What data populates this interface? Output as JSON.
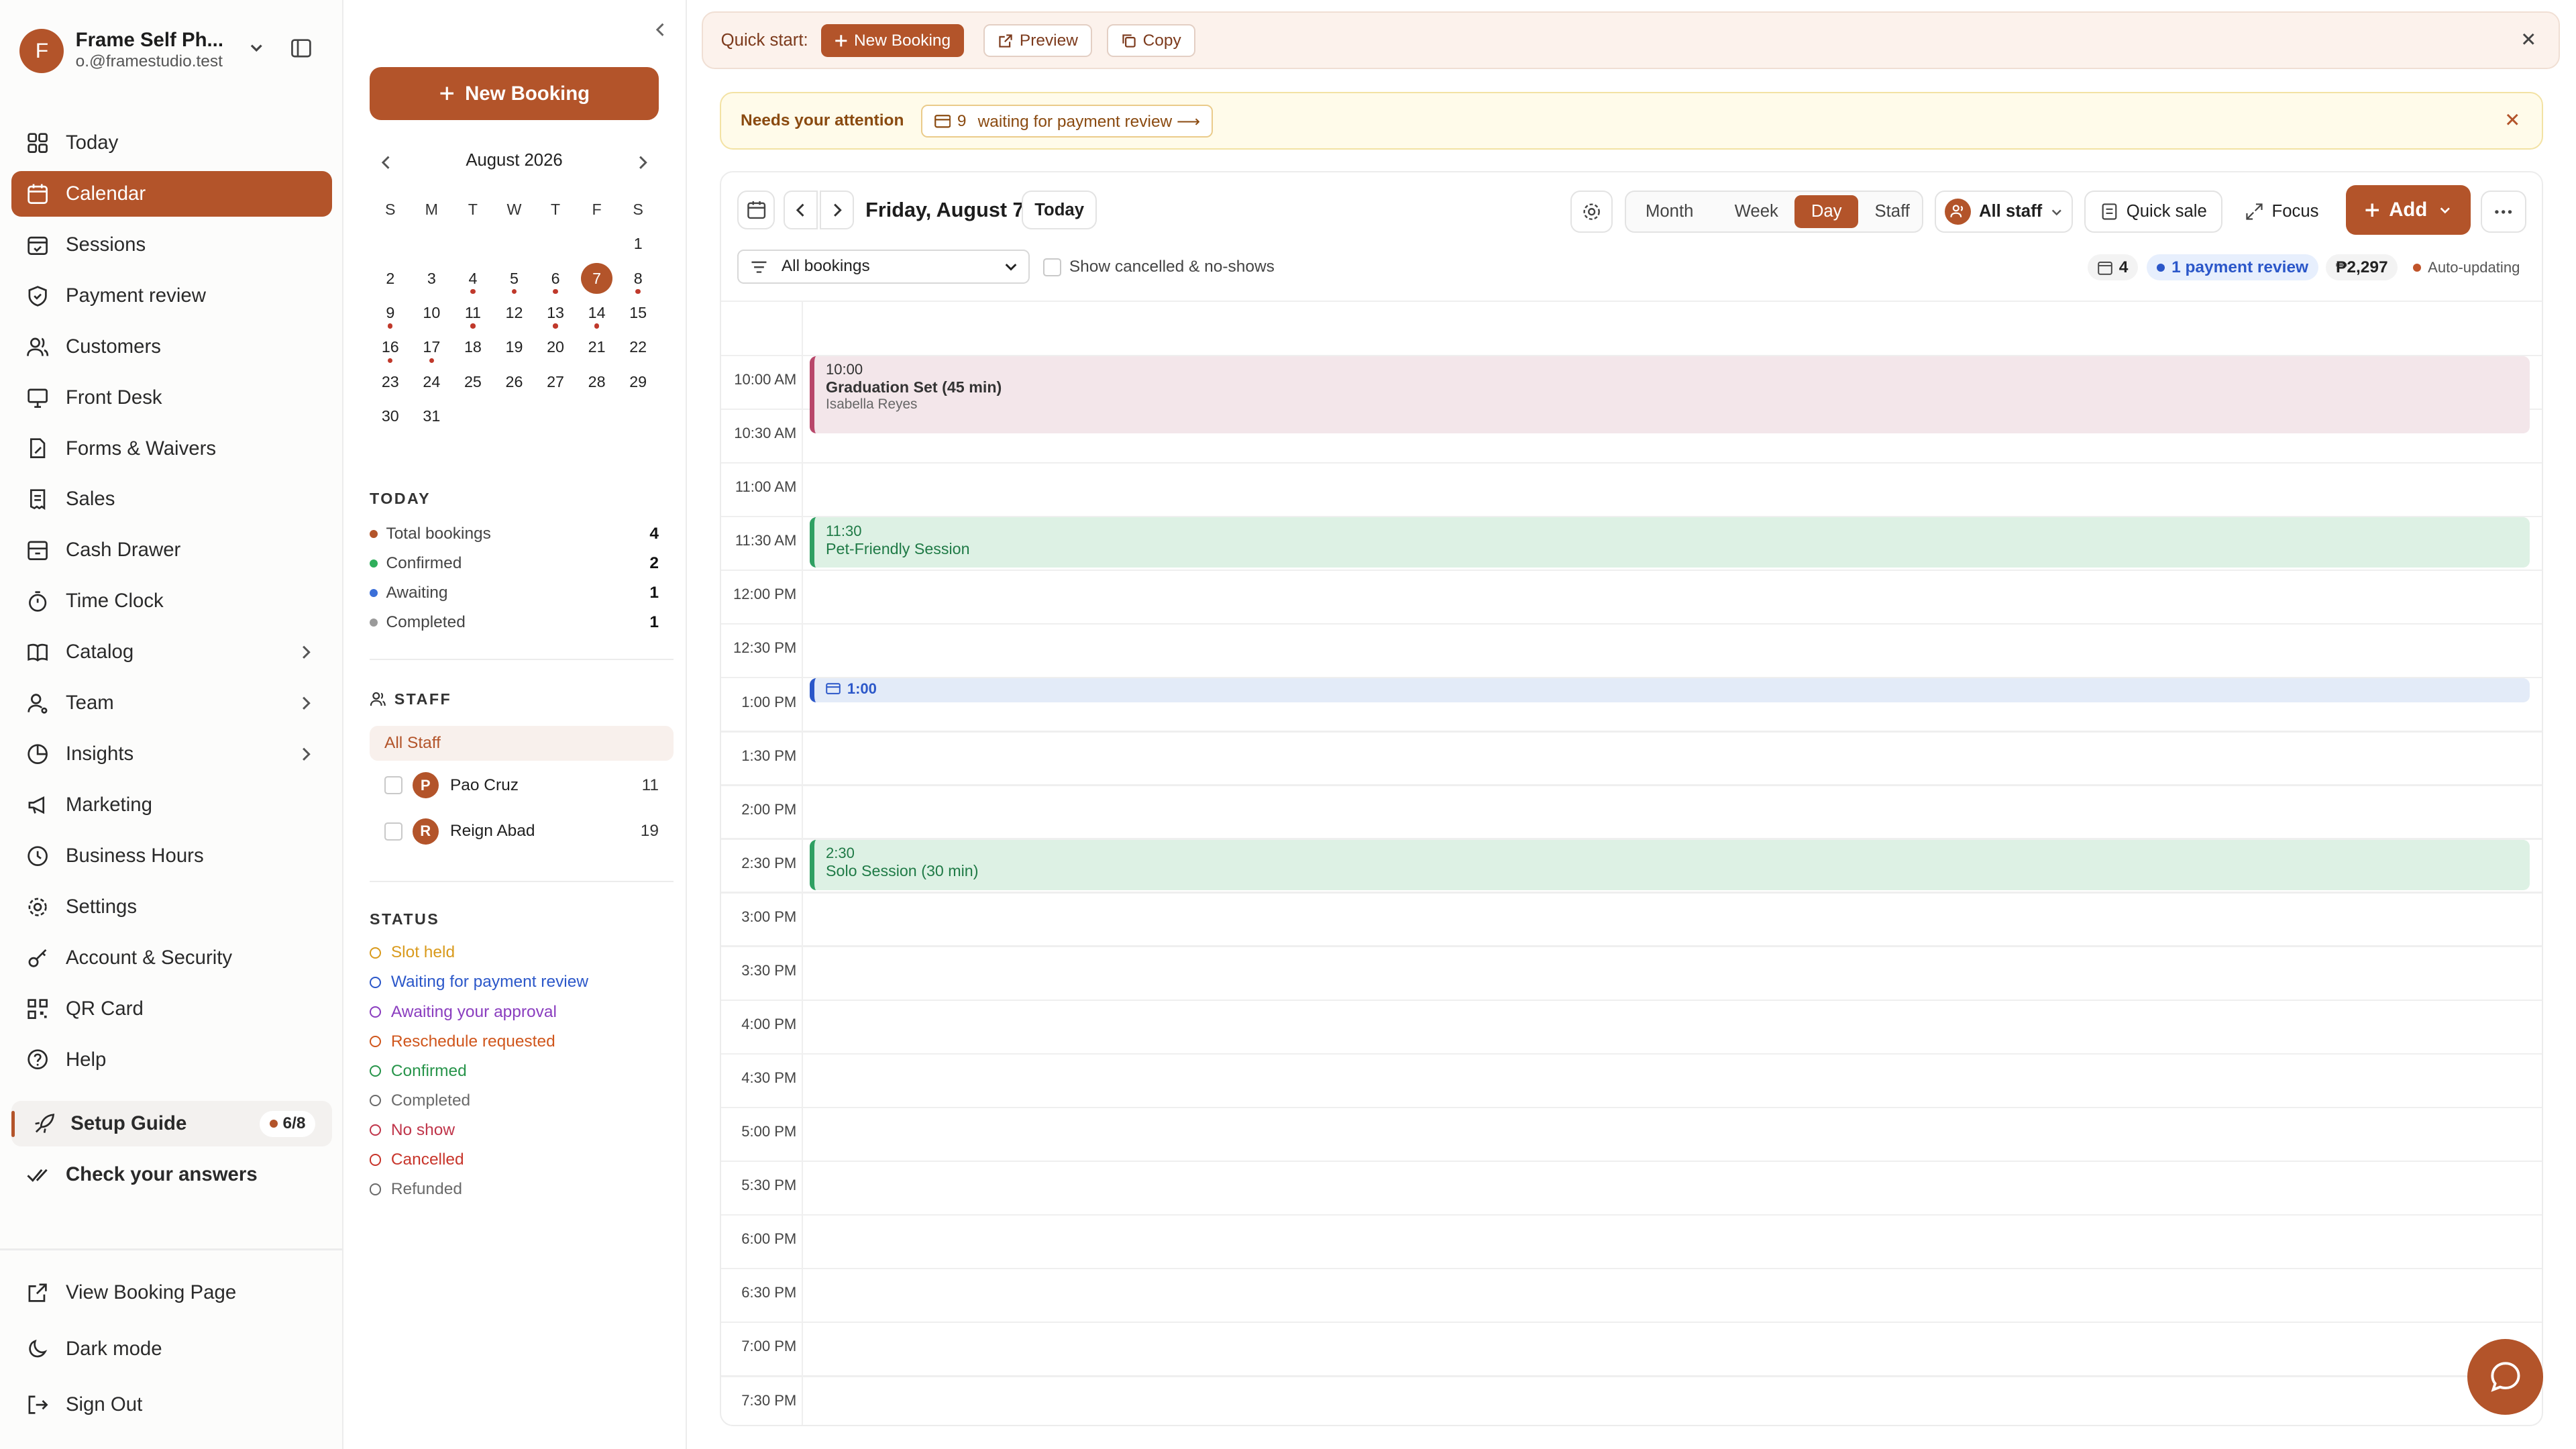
{
  "account": {
    "initial": "F",
    "name": "Frame Self Ph...",
    "email": "o.@framestudio.test"
  },
  "nav": {
    "items": [
      {
        "label": "Today"
      },
      {
        "label": "Calendar"
      },
      {
        "label": "Sessions"
      },
      {
        "label": "Payment review"
      },
      {
        "label": "Customers"
      },
      {
        "label": "Front Desk"
      },
      {
        "label": "Forms & Waivers"
      },
      {
        "label": "Sales"
      },
      {
        "label": "Cash Drawer"
      },
      {
        "label": "Time Clock"
      },
      {
        "label": "Catalog"
      },
      {
        "label": "Team"
      },
      {
        "label": "Insights"
      },
      {
        "label": "Marketing"
      },
      {
        "label": "Business Hours"
      },
      {
        "label": "Settings"
      },
      {
        "label": "Account & Security"
      },
      {
        "label": "QR Card"
      },
      {
        "label": "Help"
      }
    ],
    "setup_guide": {
      "label": "Setup Guide",
      "progress": "6/8"
    },
    "check_answers": "Check your answers",
    "bottom": [
      {
        "label": "View Booking Page"
      },
      {
        "label": "Dark mode"
      },
      {
        "label": "Sign Out"
      }
    ]
  },
  "sidebar": {
    "new_booking": "New Booking",
    "calendar": {
      "month_label": "August 2026",
      "dow": [
        "S",
        "M",
        "T",
        "W",
        "T",
        "F",
        "S"
      ],
      "weeks": [
        [
          "",
          "",
          "",
          "",
          "",
          "",
          "1"
        ],
        [
          "2",
          "3",
          "4",
          "5",
          "6",
          "7",
          "8"
        ],
        [
          "9",
          "10",
          "11",
          "12",
          "13",
          "14",
          "15"
        ],
        [
          "16",
          "17",
          "18",
          "19",
          "20",
          "21",
          "22"
        ],
        [
          "23",
          "24",
          "25",
          "26",
          "27",
          "28",
          "29"
        ],
        [
          "30",
          "31",
          "",
          "",
          "",
          "",
          ""
        ]
      ],
      "selected": "7",
      "event_days": [
        "4",
        "5",
        "6",
        "8",
        "9",
        "11",
        "13",
        "14",
        "16",
        "17"
      ]
    },
    "today": {
      "title": "TODAY",
      "rows": [
        {
          "label": "Total bookings",
          "value": "4",
          "color": "#b3542a"
        },
        {
          "label": "Confirmed",
          "value": "2",
          "color": "#2fae5b"
        },
        {
          "label": "Awaiting",
          "value": "1",
          "color": "#3b6fd8"
        },
        {
          "label": "Completed",
          "value": "1",
          "color": "#9a9a9a"
        }
      ]
    },
    "staff": {
      "title": "STAFF",
      "all": "All Staff",
      "members": [
        {
          "initial": "P",
          "name": "Pao Cruz",
          "count": "11"
        },
        {
          "initial": "R",
          "name": "Reign Abad",
          "count": "19"
        }
      ]
    },
    "status": {
      "title": "STATUS",
      "items": [
        {
          "label": "Slot held",
          "color": "#d99a1c"
        },
        {
          "label": "Waiting for payment review",
          "color": "#2b57c9"
        },
        {
          "label": "Awaiting your approval",
          "color": "#8a3dbf"
        },
        {
          "label": "Reschedule requested",
          "color": "#d0561c"
        },
        {
          "label": "Confirmed",
          "color": "#27944a"
        },
        {
          "label": "Completed",
          "color": "#6a6a6a"
        },
        {
          "label": "No show",
          "color": "#c0354a"
        },
        {
          "label": "Cancelled",
          "color": "#c8352b"
        },
        {
          "label": "Refunded",
          "color": "#6a6a6a"
        }
      ]
    }
  },
  "quick_start": {
    "label": "Quick start:",
    "new_booking": "New Booking",
    "preview": "Preview",
    "copy": "Copy"
  },
  "attention": {
    "label": "Needs your attention",
    "count": "9",
    "text": "waiting for payment review ⟶"
  },
  "toolbar": {
    "date": "Friday, August 7",
    "today": "Today",
    "views": [
      "Month",
      "Week",
      "Day",
      "Staff"
    ],
    "active_view": "Day",
    "staff_filter": "All staff",
    "quick_sale": "Quick sale",
    "focus": "Focus",
    "add": "Add",
    "filter": "All bookings",
    "show_cancelled": "Show cancelled & no-shows",
    "count": "4",
    "payment_review": "1 payment review",
    "revenue": "₱2,297",
    "auto": "Auto-updating"
  },
  "time_labels": [
    "10:00 AM",
    "10:30 AM",
    "11:00 AM",
    "11:30 AM",
    "12:00 PM",
    "12:30 PM",
    "1:00 PM",
    "1:30 PM",
    "2:00 PM",
    "2:30 PM",
    "3:00 PM",
    "3:30 PM",
    "4:00 PM",
    "4:30 PM",
    "5:00 PM",
    "5:30 PM",
    "6:00 PM",
    "6:30 PM",
    "7:00 PM",
    "7:30 PM"
  ],
  "events": [
    {
      "time": "10:00",
      "name": "Graduation Set (45 min)",
      "client": "Isabella Reyes"
    },
    {
      "time": "11:30",
      "name": "Pet-Friendly Session",
      "client": ""
    },
    {
      "time": "1:00",
      "name": "",
      "client": ""
    },
    {
      "time": "2:30",
      "name": "Solo Session (30 min)",
      "client": ""
    }
  ],
  "colors": {
    "accent": "#b3542a"
  }
}
